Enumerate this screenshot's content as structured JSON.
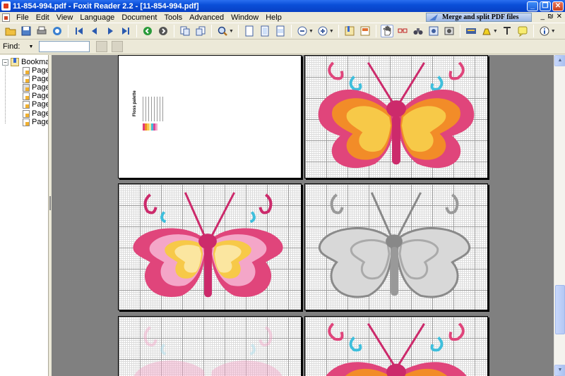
{
  "window": {
    "title": "11-854-994.pdf - Foxit Reader 2.2 - [11-854-994.pdf]",
    "buttons": [
      "_",
      "❐",
      "✕"
    ]
  },
  "menu": {
    "items": [
      "File",
      "Edit",
      "View",
      "Language",
      "Document",
      "Tools",
      "Advanced",
      "Window",
      "Help"
    ],
    "banner": "Merge and split PDF files",
    "mdi_buttons": [
      "_",
      "₪",
      "✕"
    ]
  },
  "toolbar": {
    "icons": [
      "open-icon",
      "save-icon",
      "print-icon",
      "email-icon",
      "first-page-icon",
      "previous-page-icon",
      "next-page-icon",
      "last-page-icon",
      "go-back-icon",
      "go-forward-icon",
      "rotate-left-icon",
      "rotate-right-icon",
      "zoom-icon",
      "actual-size-icon",
      "fit-page-icon",
      "fit-width-icon",
      "zoom-out-icon",
      "zoom-in-icon",
      "bookmarks-panel-icon",
      "thumbnails-panel-icon",
      "hand-tool-icon",
      "select-text-icon",
      "find-binoculars-icon",
      "snapshot-icon",
      "image-icon",
      "typewriter-icon",
      "highlight-icon",
      "text-tool-icon",
      "note-icon",
      "info-icon"
    ]
  },
  "find": {
    "label": "Find:",
    "value": "",
    "placeholder": ""
  },
  "bookmarks": {
    "root_label": "Bookmarks",
    "root_toggle": "−",
    "pages": [
      "Page",
      "Page",
      "Page",
      "Page",
      "Page",
      "Page",
      "Page"
    ]
  },
  "palette": {
    "title": "Floss palette",
    "swatch_colors": [
      "#e33b7a",
      "#f28c28",
      "#f7c948",
      "#f9e79f",
      "#3fbfdc",
      "#d84a9a",
      "#f4a6c8"
    ]
  },
  "colors": {
    "titlebar": "#0a4fd8",
    "pink": "#e0457b",
    "magenta": "#cc2a6b",
    "orange": "#f28c28",
    "yellow": "#f7c948",
    "pale_yellow": "#fbe6a0",
    "cyan": "#3fbfdc",
    "page_bg": "#808080"
  }
}
